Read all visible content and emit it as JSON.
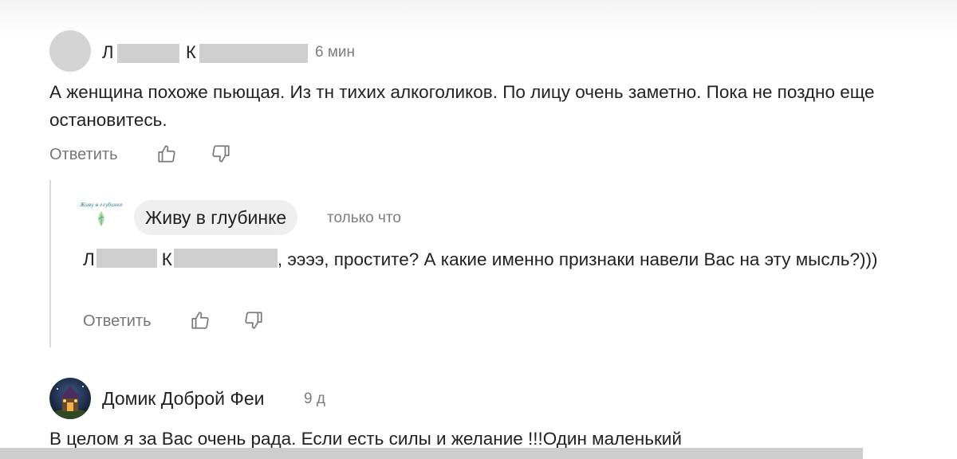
{
  "comment1": {
    "author_first": "Л",
    "author_last": "К",
    "time": "6 мин",
    "text": "А женщина похоже пьющая. Из тн тихих алкоголиков. По лицу очень заметно. Пока не поздно еще остановитесь.",
    "reply_label": "Ответить"
  },
  "reply": {
    "logo_text": "Живу в глубинке",
    "channel_name": "Живу в глубинке",
    "time": "только что",
    "mention_first": "Л",
    "mention_last": "К",
    "text": ", ээээ, простите? А какие именно признаки навели Вас на эту мысль?)))",
    "reply_label": "Ответить"
  },
  "comment2": {
    "author": "Домик Доброй Феи",
    "time": "9 д",
    "text": "В целом я за Вас очень рада. Если есть силы и желание !!!Один маленький"
  },
  "colors": {
    "redaction": "#cfcfcf",
    "chip_bg": "#efefef",
    "muted_text": "#767676"
  },
  "icons": {
    "like": "thumbs-up-icon",
    "dislike": "thumbs-down-icon"
  }
}
